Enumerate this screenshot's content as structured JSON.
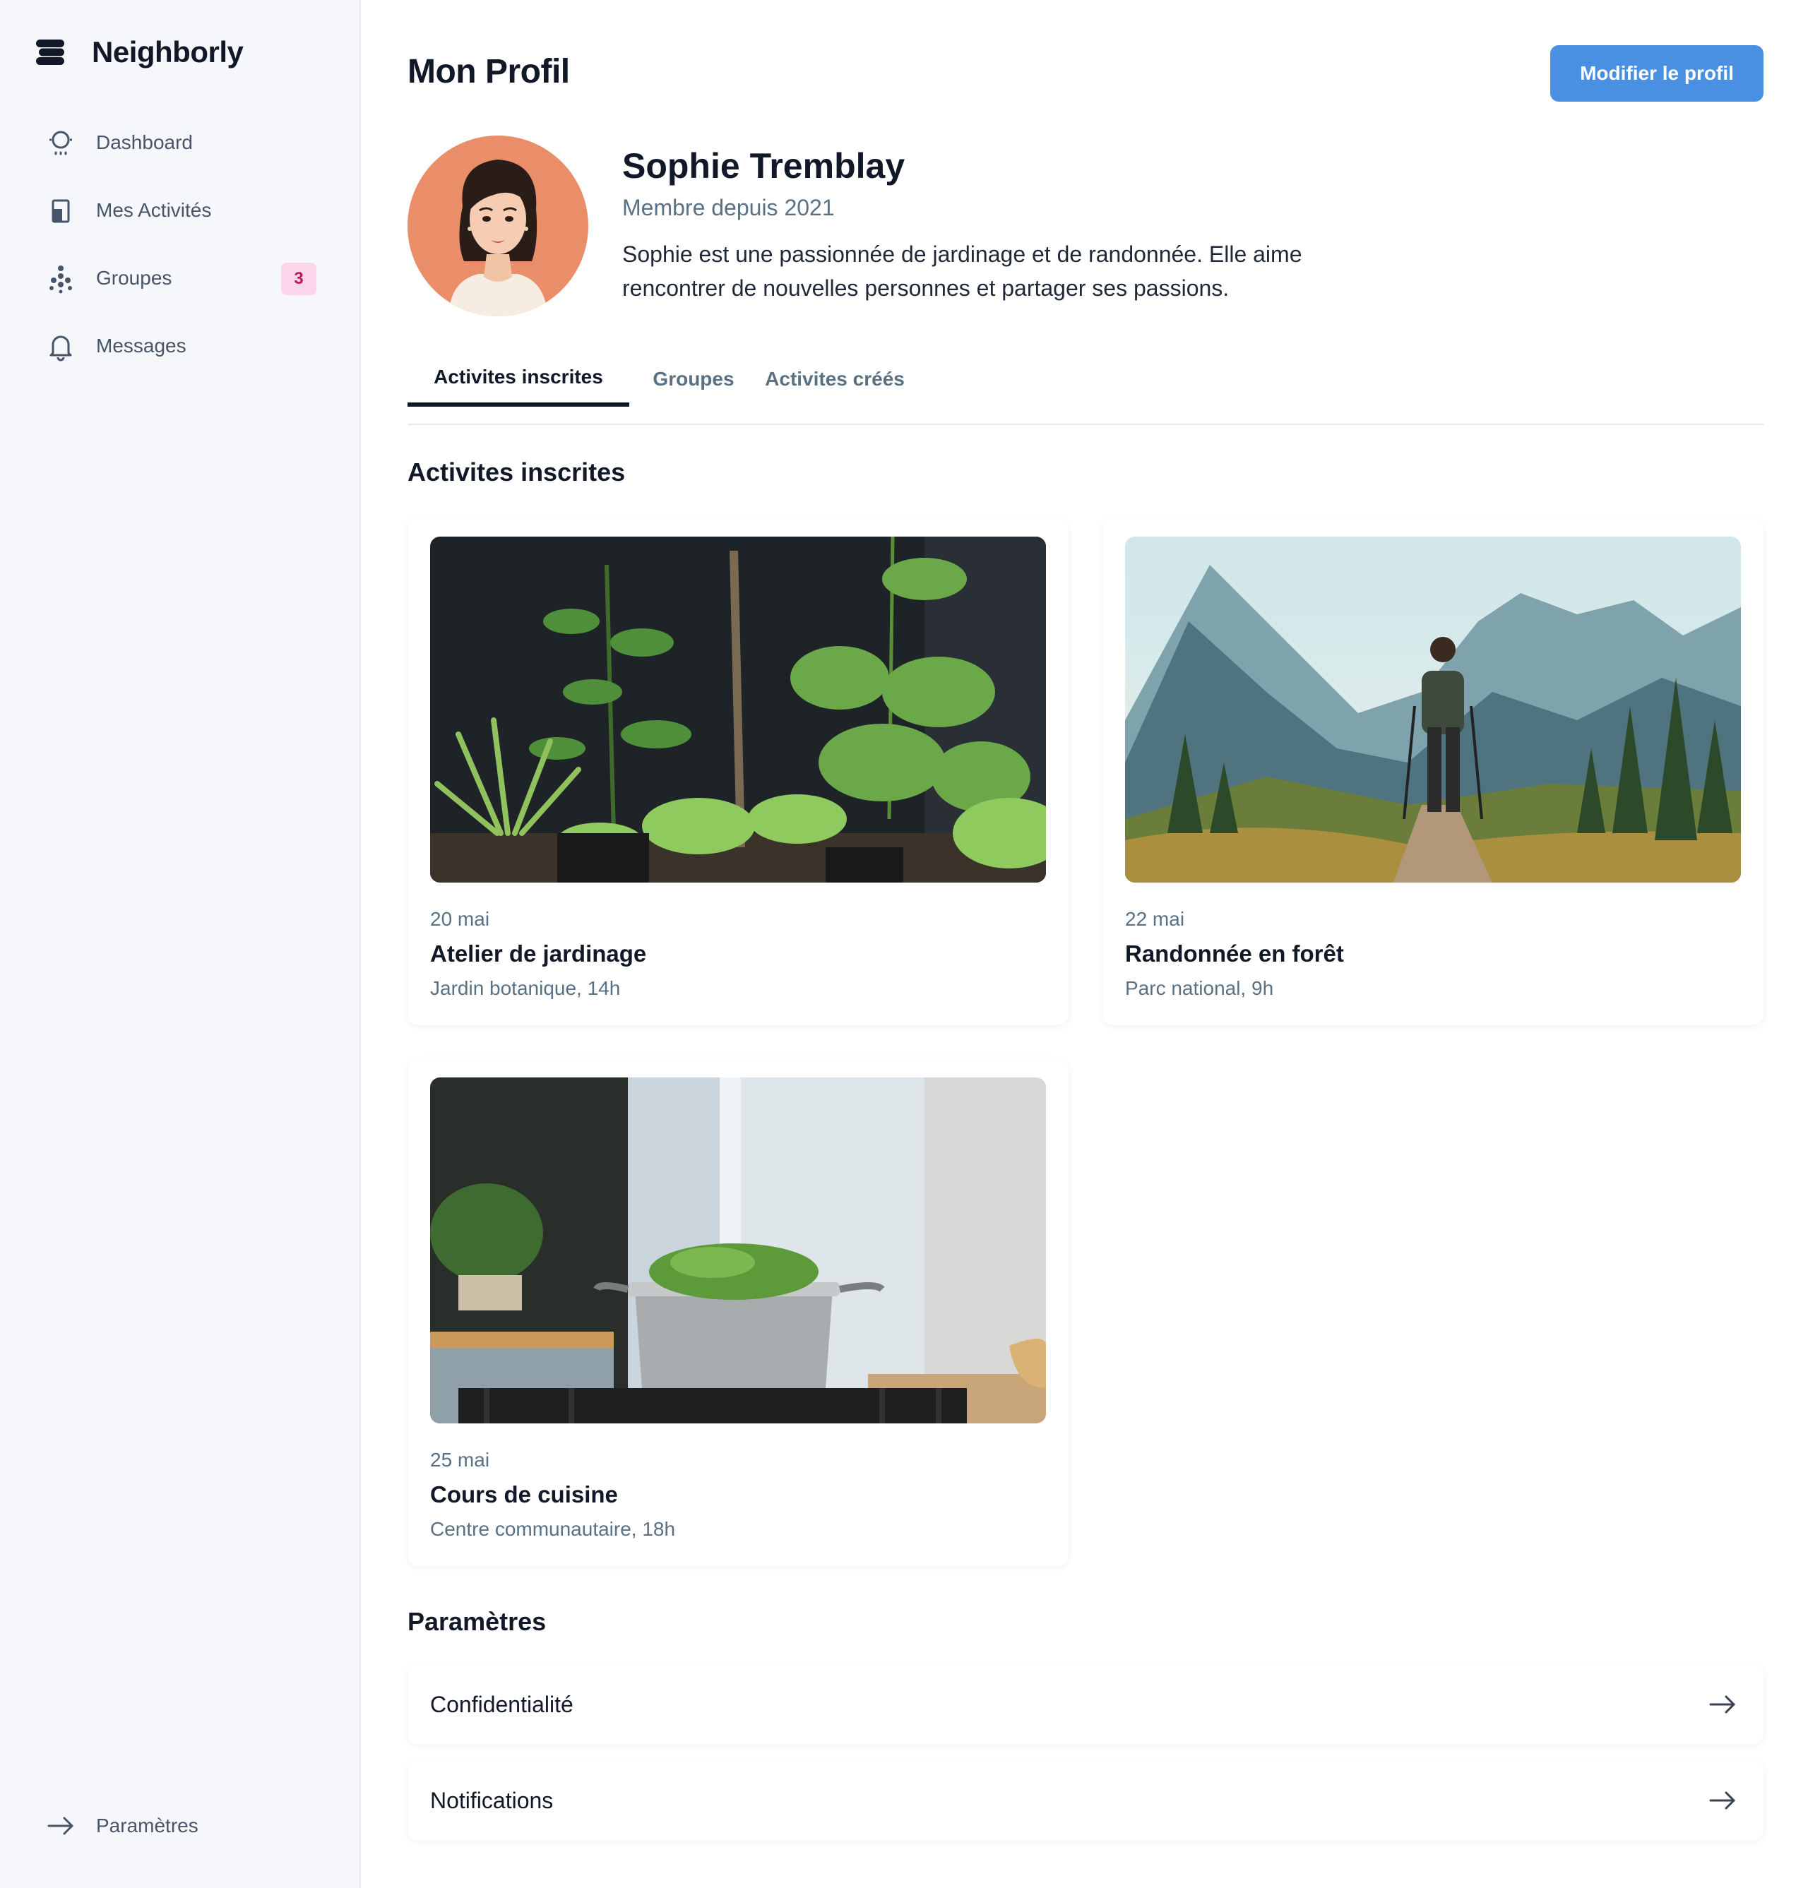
{
  "app": {
    "name": "Neighborly"
  },
  "sidebar": {
    "items": [
      {
        "label": "Dashboard",
        "icon": "dashboard-icon"
      },
      {
        "label": "Mes Activités",
        "icon": "tablet-icon"
      },
      {
        "label": "Groupes",
        "icon": "groups-icon",
        "badge": "3"
      },
      {
        "label": "Messages",
        "icon": "bell-icon"
      }
    ],
    "footer": {
      "label": "Paramètres",
      "icon": "arrow-right-icon"
    }
  },
  "header": {
    "title": "Mon Profil",
    "edit_label": "Modifier le profil"
  },
  "profile": {
    "name": "Sophie Tremblay",
    "since": "Membre depuis 2021",
    "bio": "Sophie est une passionnée de jardinage et de randonnée. Elle aime rencontrer de nouvelles personnes et partager ses passions."
  },
  "tabs": [
    {
      "label": "Activites inscrites",
      "active": true
    },
    {
      "label": "Groupes",
      "active": false
    },
    {
      "label": "Activites créés",
      "active": false
    }
  ],
  "activities": {
    "title": "Activites inscrites",
    "items": [
      {
        "date": "20 mai",
        "title": "Atelier de jardinage",
        "place": "Jardin botanique, 14h",
        "image": "plants-photo"
      },
      {
        "date": "22 mai",
        "title": "Randonnée en forêt",
        "place": "Parc national, 9h",
        "image": "mountain-hiker-photo"
      },
      {
        "date": "25 mai",
        "title": "Cours de cuisine",
        "place": "Centre communautaire, 18h",
        "image": "cooking-pot-photo"
      }
    ]
  },
  "settings": {
    "title": "Paramètres",
    "items": [
      {
        "label": "Confidentialité"
      },
      {
        "label": "Notifications"
      }
    ]
  },
  "colors": {
    "accent": "#4a90e2",
    "badge_bg": "#fbd5ea",
    "badge_text": "#be185d",
    "sidebar_bg": "#f5f7fa",
    "avatar_bg": "#e98e68"
  }
}
